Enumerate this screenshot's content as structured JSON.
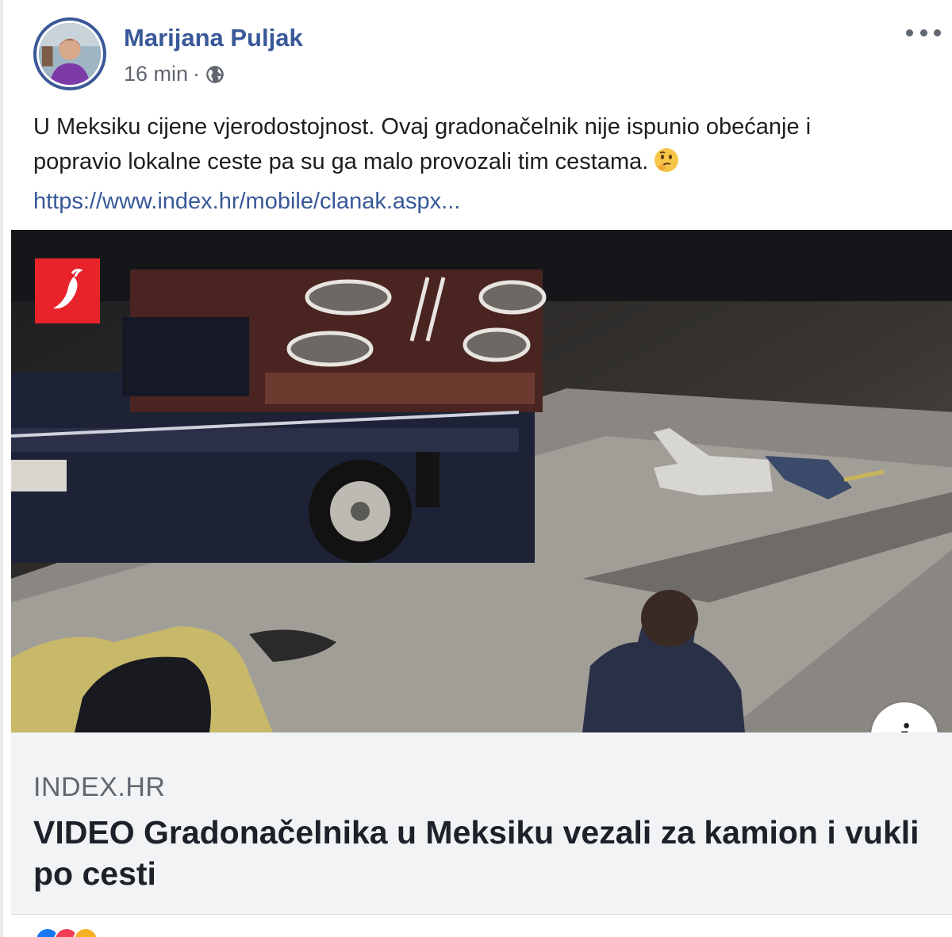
{
  "post": {
    "author": "Marijana Puljak",
    "time": "16 min",
    "separator": "·",
    "privacy_icon": "globe-icon",
    "more_icon": "more-options-icon",
    "text_line_1": "U Meksiku cijene vjerodostojnost. Ovaj gradonačelnik nije ispunio obećanje i",
    "text_line_2": "popravio lokalne ceste pa su ga malo provozali tim cestama.",
    "emoji": "thinking-face-emoji",
    "link_text": "https://www.index.hr/mobile/clanak.aspx..."
  },
  "media": {
    "publisher_logo": "chili-pepper-logo",
    "info_icon_label": "i"
  },
  "link_preview": {
    "domain": "INDEX.HR",
    "headline": "VIDEO Gradonačelnika u Meksiku vezali za kamion i vukli po cesti"
  },
  "colors": {
    "author_blue": "#385898",
    "logo_red": "#e8232a",
    "preview_bg": "#f2f3f5"
  }
}
